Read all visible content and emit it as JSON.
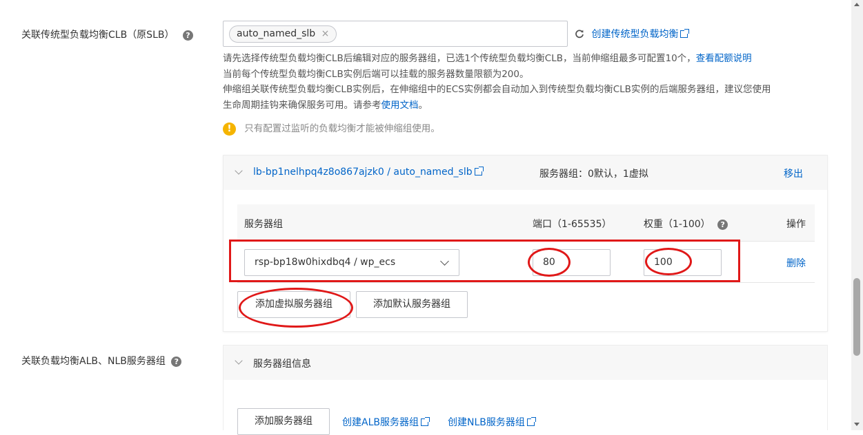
{
  "clb_section": {
    "label": "关联传统型负载均衡CLB（原SLB）",
    "help": "?",
    "selected_tag": "auto_named_slb",
    "tag_close": "×",
    "create_link": "创建传统型负载均衡",
    "desc_line1": "请先选择传统型负载均衡CLB后编辑对应的服务器组，已选1个传统型负载均衡CLB，当前伸缩组最多可配置10个，",
    "quota_link": "查看配额说明",
    "desc_line2": "当前每个传统型负载均衡CLB实例后端可以挂载的服务器数量限额为200。",
    "desc_line3": "伸缩组关联传统型负载均衡CLB实例后，在伸缩组中的ECS实例都会自动加入到传统型负载均衡CLB实例的后端服务器组，建议您使用",
    "desc_line4_prefix": "生命周期挂钩来确保服务可用。请参考",
    "doc_link": "使用文档",
    "desc_line4_suffix": "。",
    "warning_icon": "!",
    "warning": "只有配置过监听的负载均衡才能被伸缩组使用。"
  },
  "clb_panel": {
    "instance_link": "lb-bp1nelhpq4z8o867ajzk0 / auto_named_slb",
    "server_group_summary": "服务器组：0默认，1虚拟",
    "remove": "移出",
    "table": {
      "col_group": "服务器组",
      "col_port": "端口（1-65535）",
      "col_weight": "权重（1-100）",
      "col_action": "操作",
      "rows": [
        {
          "group": "rsp-bp18w0hixdbq4 / wp_ecs",
          "port": "80",
          "weight": "100",
          "action": "删除"
        }
      ]
    },
    "add_virtual_button": "添加虚拟服务器组",
    "add_default_button": "添加默认服务器组"
  },
  "alb_section": {
    "label": "关联负载均衡ALB、NLB服务器组",
    "help": "?",
    "panel_title": "服务器组信息",
    "add_button": "添加服务器组",
    "create_alb_link": "创建ALB服务器组",
    "create_nlb_link": "创建NLB服务器组"
  },
  "colors": {
    "link": "#0064c8",
    "annotation_red": "#e01818",
    "warning_yellow": "#f5b400",
    "panel_bg": "#f7f7f7"
  },
  "icons": [
    "help-icon",
    "refresh-icon",
    "external-link-icon",
    "warning-icon",
    "chevron-down-icon",
    "tag-close-icon"
  ]
}
